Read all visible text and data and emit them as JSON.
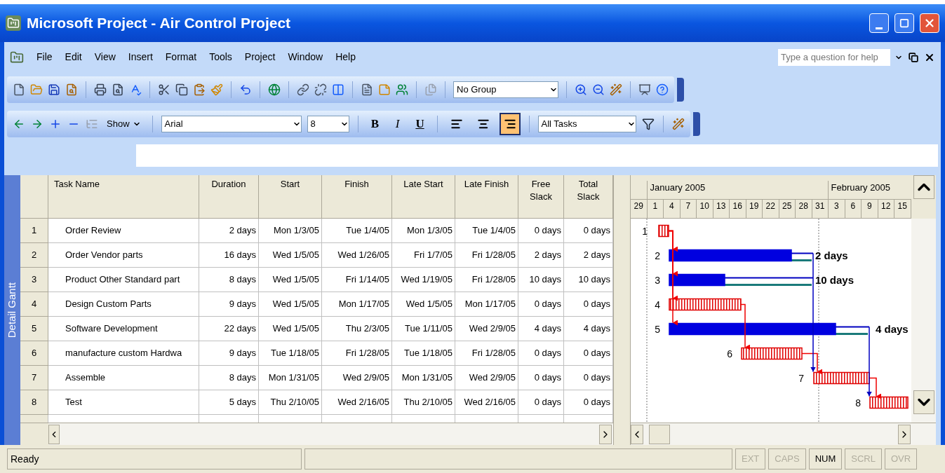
{
  "window": {
    "title": "Microsoft Project - Air Control Project"
  },
  "menu_bar": {
    "items": [
      "File",
      "Edit",
      "View",
      "Insert",
      "Format",
      "Tools",
      "Project",
      "Window",
      "Help"
    ],
    "help_box": {
      "placeholder": "Type a question for help"
    }
  },
  "standard_toolbar": {
    "group_dropdown": {
      "value": "No Group"
    }
  },
  "formatting_toolbar": {
    "show_button": "Show",
    "font": {
      "value": "Arial"
    },
    "size": {
      "value": "8"
    },
    "style_buttons": [
      {
        "label": "B",
        "kind": "bold"
      },
      {
        "label": "I",
        "kind": "italic"
      },
      {
        "label": "U",
        "kind": "underline"
      }
    ],
    "align_buttons": [
      {
        "kind": "left",
        "selected": false
      },
      {
        "kind": "center",
        "selected": false
      },
      {
        "kind": "right",
        "selected": true
      }
    ],
    "filter": {
      "value": "All Tasks"
    }
  },
  "view_bar": {
    "label": "Detail Gantt"
  },
  "table": {
    "columns": [
      "Task Name",
      "Duration",
      "Start",
      "Finish",
      "Late Start",
      "Late Finish",
      "Free Slack",
      "Total Slack"
    ],
    "rows": [
      {
        "id": "1",
        "cells": [
          "Order Review",
          "2 days",
          "Mon 1/3/05",
          "Tue 1/4/05",
          "Mon 1/3/05",
          "Tue 1/4/05",
          "0 days",
          "0 days"
        ]
      },
      {
        "id": "2",
        "cells": [
          "Order Vendor parts",
          "16 days",
          "Wed 1/5/05",
          "Wed 1/26/05",
          "Fri 1/7/05",
          "Fri 1/28/05",
          "2 days",
          "2 days"
        ]
      },
      {
        "id": "3",
        "cells": [
          "Product Other Standard part",
          "8 days",
          "Wed 1/5/05",
          "Fri 1/14/05",
          "Wed 1/19/05",
          "Fri 1/28/05",
          "10 days",
          "10 days"
        ]
      },
      {
        "id": "4",
        "cells": [
          "Design Custom Parts",
          "9 days",
          "Wed 1/5/05",
          "Mon 1/17/05",
          "Wed 1/5/05",
          "Mon 1/17/05",
          "0 days",
          "0 days"
        ]
      },
      {
        "id": "5",
        "cells": [
          "Software Development",
          "22 days",
          "Wed 1/5/05",
          "Thu 2/3/05",
          "Tue 1/11/05",
          "Wed 2/9/05",
          "4 days",
          "4 days"
        ]
      },
      {
        "id": "6",
        "cells": [
          "manufacture custom Hardwa",
          "9 days",
          "Tue 1/18/05",
          "Fri 1/28/05",
          "Tue 1/18/05",
          "Fri 1/28/05",
          "0 days",
          "0 days"
        ]
      },
      {
        "id": "7",
        "cells": [
          "Assemble",
          "8 days",
          "Mon 1/31/05",
          "Wed 2/9/05",
          "Mon 1/31/05",
          "Wed 2/9/05",
          "0 days",
          "0 days"
        ]
      },
      {
        "id": "8",
        "cells": [
          "Test",
          "5 days",
          "Thu 2/10/05",
          "Wed 2/16/05",
          "Thu 2/10/05",
          "Wed 2/16/05",
          "0 days",
          "0 days"
        ]
      }
    ]
  },
  "gantt": {
    "months": [
      "January 2005",
      "February 2005"
    ],
    "days": [
      "29",
      "1",
      "4",
      "7",
      "10",
      "13",
      "16",
      "19",
      "22",
      "25",
      "28",
      "31",
      "3",
      "6",
      "9",
      "12",
      "15"
    ],
    "bars": [
      {
        "label": "1",
        "critical": true
      },
      {
        "label": "2",
        "critical": false,
        "slack_label": "2 days"
      },
      {
        "label": "3",
        "critical": false,
        "slack_label": "10 days"
      },
      {
        "label": "4",
        "critical": true
      },
      {
        "label": "5",
        "critical": false,
        "slack_label": "4 days"
      },
      {
        "label": "6",
        "critical": true
      },
      {
        "label": "7",
        "critical": true
      },
      {
        "label": "8",
        "critical": true
      }
    ]
  },
  "status_bar": {
    "text": "Ready",
    "indicators": [
      {
        "label": "EXT",
        "active": false
      },
      {
        "label": "CAPS",
        "active": false
      },
      {
        "label": "NUM",
        "active": true
      },
      {
        "label": "SCRL",
        "active": false
      },
      {
        "label": "OVR",
        "active": false
      }
    ]
  }
}
